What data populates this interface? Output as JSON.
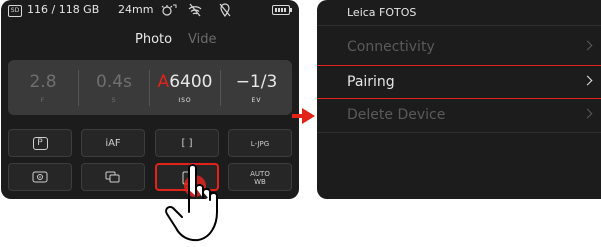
{
  "camera": {
    "status": {
      "storage": "116 / 118 GB",
      "focal_length": "24mm",
      "sd_label": "SD"
    },
    "mode": {
      "active": "Photo",
      "inactive": "Vide"
    },
    "exposure": [
      {
        "value": "2.8",
        "label": "F"
      },
      {
        "value": "0.4s",
        "label": "S"
      },
      {
        "value_prefix": "A",
        "value": "6400",
        "label": "ISO"
      },
      {
        "value": "−1/3",
        "label": "EV"
      }
    ],
    "tiles": [
      {
        "label": "P",
        "icon": "program-mode-icon"
      },
      {
        "label": "iAF"
      },
      {
        "label": "[ ]",
        "icon": "focus-field-icon"
      },
      {
        "label": "L-JPG"
      },
      {
        "label": "",
        "icon": "metering-icon"
      },
      {
        "label": "",
        "icon": "drive-mode-icon"
      },
      {
        "label": "",
        "icon": "smartphone-icon"
      },
      {
        "label_line1": "AUTO",
        "label_line2": "WB"
      }
    ]
  },
  "menu": {
    "title": "Leica FOTOS",
    "items": [
      {
        "label": "Connectivity"
      },
      {
        "label": "Pairing"
      },
      {
        "label": "Delete Device"
      }
    ]
  },
  "colors": {
    "accent": "#e2231a",
    "screen_bg": "#1c1c1c"
  }
}
